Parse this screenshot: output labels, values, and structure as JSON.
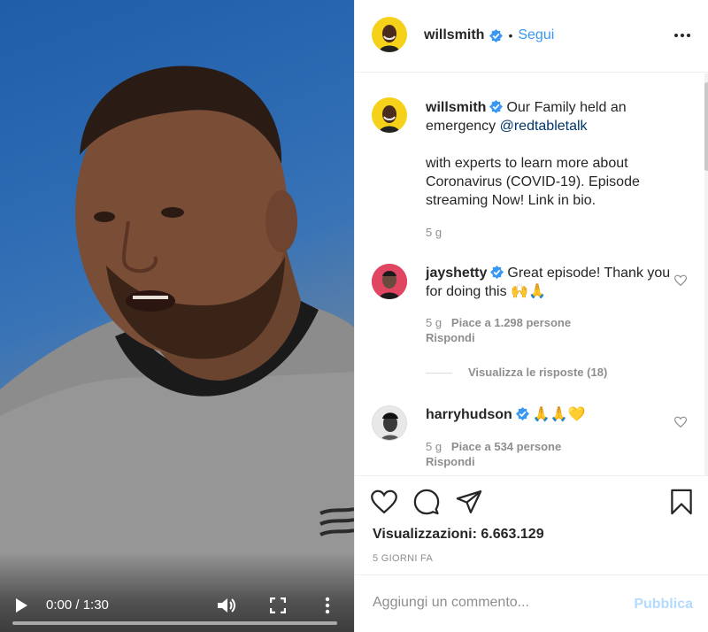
{
  "video": {
    "time": "0:00 / 1:30",
    "progress_fraction": 0.0
  },
  "header": {
    "username": "willsmith",
    "separator": "•",
    "follow_label": "Segui"
  },
  "caption": {
    "username": "willsmith",
    "line1": "Our Family held an emergency ",
    "mention": "@redtabletalk",
    "line2": "with experts to learn more about Coronavirus (COVID-19). Episode streaming Now! Link in bio.",
    "age": "5 g"
  },
  "comments": [
    {
      "username": "jayshetty",
      "text": "Great episode! Thank you for doing this 🙌🙏",
      "age": "5 g",
      "likes": "Piace a 1.298 persone",
      "reply": "Rispondi",
      "view_replies": "Visualizza le risposte (18)"
    },
    {
      "username": "harryhudson",
      "text": "🙏🙏💛",
      "age": "5 g",
      "likes": "Piace a 534 persone",
      "reply": "Rispondi"
    }
  ],
  "actions": {
    "views_label": "Visualizzazioni:",
    "views_count": "6.663.129",
    "date": "5 GIORNI FA"
  },
  "add_comment": {
    "placeholder": "Aggiungi un commento...",
    "publish_label": "Pubblica"
  },
  "colors": {
    "accent": "#3897f0",
    "avatar_ring": "#f5d219",
    "publish_disabled": "#b3dbff"
  }
}
